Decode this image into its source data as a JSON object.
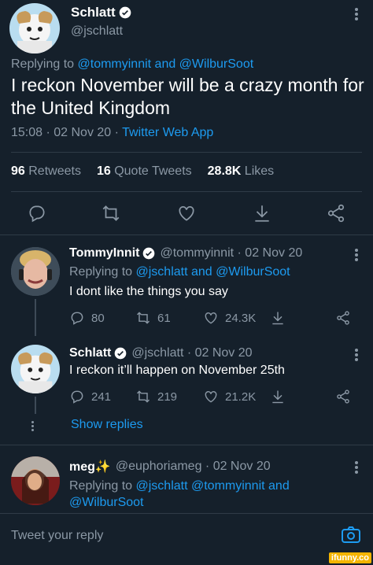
{
  "main_tweet": {
    "author_name": "Schlatt",
    "author_handle": "@jschlatt",
    "replying_prefix": "Replying to",
    "replying_to": "@tommyinnit and @WilburSoot",
    "text": "I reckon November will be a crazy month for the United Kingdom",
    "time": "15:08 · 02 Nov 20 · ",
    "source": "Twitter Web App",
    "stats": {
      "retweets_count": "96",
      "retweets_label": "Retweets",
      "quotes_count": "16",
      "quotes_label": "Quote Tweets",
      "likes_count": "28.8K",
      "likes_label": "Likes"
    }
  },
  "reply1": {
    "author_name": "TommyInnit",
    "meta": "@tommyinnit · 02 Nov 20",
    "replying_prefix": "Replying to ",
    "replying_to": "@jschlatt and @WilburSoot",
    "text": "I dont like the things you say",
    "replies": "80",
    "retweets": "61",
    "likes": "24.3K"
  },
  "reply2": {
    "author_name": "Schlatt",
    "meta": "@jschlatt · 02 Nov 20",
    "text": "I reckon it’ll happen on November 25th",
    "replies": "241",
    "retweets": "219",
    "likes": "21.2K",
    "show_replies": "Show replies"
  },
  "reply3": {
    "author_name": "meg✨",
    "meta": "@euphoriameg · 02 Nov 20",
    "replying_prefix": "Replying to ",
    "replying_to_line1": "@jschlatt @tommyinnit and",
    "replying_to_line2": "@WilburSoot"
  },
  "composer": {
    "placeholder": "Tweet your reply"
  },
  "watermark": "ifunny.co",
  "colors": {
    "background": "#15202b",
    "accent": "#1d9bf0",
    "muted": "#8b98a5"
  }
}
